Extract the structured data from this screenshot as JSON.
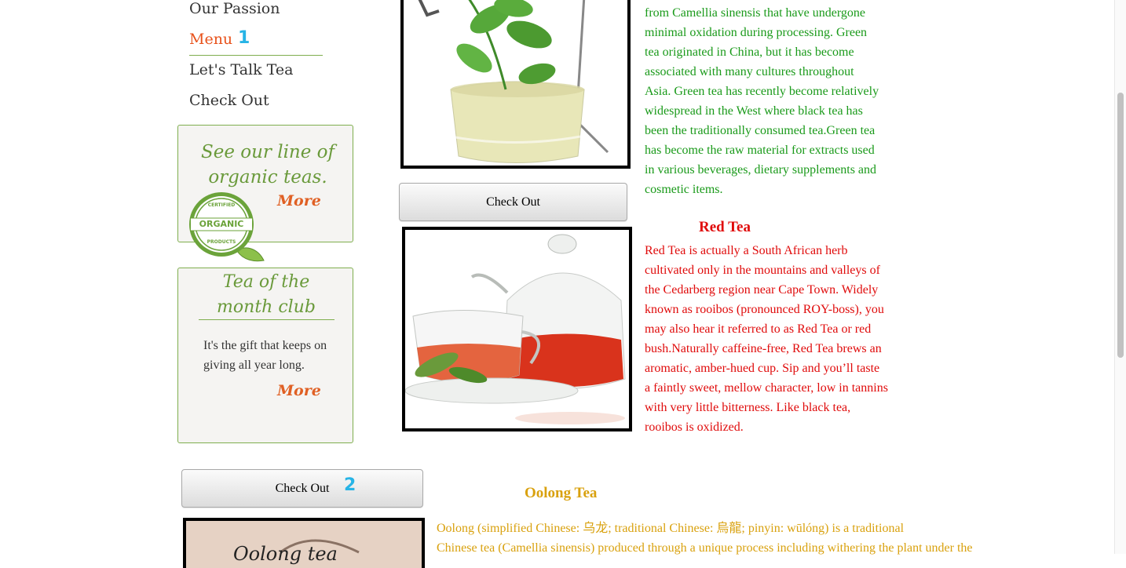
{
  "nav": {
    "items": [
      {
        "label": "Our Passion"
      },
      {
        "label": "Menu",
        "annotation": "1"
      },
      {
        "label": "Let's Talk Tea"
      },
      {
        "label": "Check Out"
      }
    ]
  },
  "organic_box": {
    "title": "See our line of organic teas.",
    "more": "More",
    "badge": {
      "top": "CERTIFIED",
      "main": "ORGANIC",
      "bottom": "PRODUCTS"
    }
  },
  "club_box": {
    "title": "Tea of the month club",
    "text": "It's the gift that keeps on giving all year long.",
    "more": "More"
  },
  "buttons": {
    "checkout_1": "Check Out",
    "checkout_2": "Check Out",
    "checkout_2_annotation": "2"
  },
  "green_tea": {
    "text": "from Camellia sinensis that have undergone minimal oxidation during processing. Green tea originated in China, but it has become associated with many cultures throughout Asia. Green tea has recently become relatively widespread in the West where black tea has been the traditionally consumed tea.Green tea has become the raw material for extracts used in various beverages, dietary supplements and cosmetic items."
  },
  "red_tea": {
    "title": "Red Tea",
    "text": "Red Tea is actually a South African herb cultivated only in the mountains and valleys of the Cedarberg region near Cape Town. Widely known as rooibos (pronounced ROY-boss), you may also hear it referred to as Red Tea or red bush.Naturally caffeine-free, Red Tea brews an aromatic, amber-hued cup. Sip and you’ll taste a faintly sweet, mellow character, low in tannins with very little bitterness. Like black tea, rooibos is oxidized."
  },
  "oolong_tea": {
    "title": "Oolong Tea",
    "line1": "Oolong (simplified Chinese: 乌龙; traditional Chinese: 烏龍; pinyin: wūlóng) is a traditional",
    "line2": "Chinese tea (Camellia sinensis) produced through a unique process including withering the plant under the",
    "image_text": "Oolong tea"
  },
  "colors": {
    "nav_active": "#e8511a",
    "green_text": "#1a9a1a",
    "red_text": "#e00b0b",
    "oolong_text": "#d9a10e",
    "box_border": "#7fae4e",
    "annotation": "#27b4e6"
  }
}
